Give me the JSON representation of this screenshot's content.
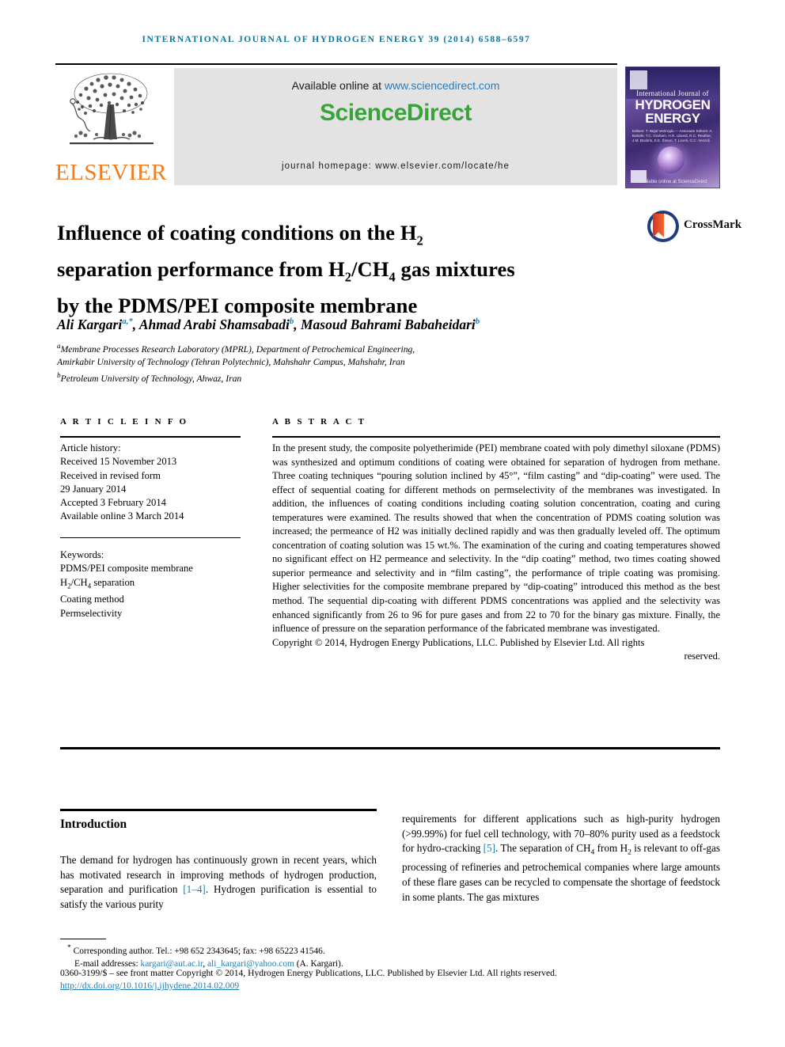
{
  "running_head": "International Journal of Hydrogen Energy 39 (2014) 6588–6597",
  "masthead": {
    "publisher_name": "ELSEVIER",
    "publisher_logo": "elsevier-tree-logo",
    "available_online_prefix": "Available online at ",
    "sciencedirect_url": "www.sciencedirect.com",
    "sciencedirect_logo_text": "ScienceDirect",
    "journal_homepage": "journal homepage: www.elsevier.com/locate/he",
    "cover": {
      "small_title": "International Journal of",
      "large_title_line1": "HYDROGEN",
      "large_title_line2": "ENERGY",
      "editors_text": "Editors: T. Nejat Veziroglu — Associate Editors: A. Bartels, T.C. Graham, H.R. Liburdi, R.C. Reuther, J.M. Bockris, E.E. Šimon, T. Loveli, G.C. Vezzoli",
      "footer_text": "Available online at ScienceDirect"
    }
  },
  "article": {
    "title_line1_pre": "Influence of coating conditions on the H",
    "title_h2_sub": "2",
    "title_line2_pre": "separation performance from H",
    "title_line2_mid": "/CH",
    "title_ch4_sub": "4",
    "title_line2_post": " gas mixtures",
    "title_line3": "by the PDMS/PEI composite membrane",
    "title_plain": "Influence of coating conditions on the H2 separation performance from H2/CH4 gas mixtures by the PDMS/PEI composite membrane",
    "crossmark_label": "CrossMark",
    "authors": [
      {
        "name": "Ali Kargari",
        "marks": "a,*"
      },
      {
        "name": "Ahmad Arabi Shamsabadi",
        "marks": "b"
      },
      {
        "name": "Masoud Bahrami Babaheidari",
        "marks": "b"
      }
    ],
    "affiliations": [
      {
        "mark": "a",
        "line1": "Membrane Processes Research Laboratory (MPRL), Department of Petrochemical Engineering,",
        "line2": "Amirkabir University of Technology (Tehran Polytechnic), Mahshahr Campus, Mahshahr, Iran"
      },
      {
        "mark": "b",
        "line1": "Petroleum University of Technology, Ahwaz, Iran",
        "line2": ""
      }
    ]
  },
  "article_info": {
    "heading": "A R T I C L E   I N F O",
    "history_label": "Article history:",
    "history": [
      "Received 15 November 2013",
      "Received in revised form",
      "29 January 2014",
      "Accepted 3 February 2014",
      "Available online 3 March 2014"
    ],
    "keywords_label": "Keywords:",
    "keywords": [
      "PDMS/PEI composite membrane",
      "H2/CH4 separation",
      "Coating method",
      "Permselectivity"
    ]
  },
  "abstract": {
    "heading": "A B S T R A C T",
    "body": "In the present study, the composite polyetherimide (PEI) membrane coated with poly dimethyl siloxane (PDMS) was synthesized and optimum conditions of coating were obtained for separation of hydrogen from methane. Three coating techniques “pouring solution inclined by 45°”, “film casting” and “dip-coating” were used. The effect of sequential coating for different methods on permselectivity of the membranes was investigated. In addition, the influences of coating conditions including coating solution concentration, coating and curing temperatures were examined. The results showed that when the concentration of PDMS coating solution was increased; the permeance of H2 was initially declined rapidly and was then gradually leveled off. The optimum concentration of coating solution was 15 wt.%. The examination of the curing and coating temperatures showed no significant effect on H2 permeance and selectivity. In the “dip coating” method, two times coating showed superior permeance and selectivity and in “film casting”, the performance of triple coating was promising. Higher selectivities for the composite membrane prepared by “dip-coating” introduced this method as the best method. The sequential dip-coating with different PDMS concentrations was applied and the selectivity was enhanced significantly from 26 to 96 for pure gases and from 22 to 70 for the binary gas mixture. Finally, the influence of pressure on the separation performance of the fabricated membrane was investigated.",
    "copyright": "Copyright © 2014, Hydrogen Energy Publications, LLC. Published by Elsevier Ltd. All rights",
    "copyright_last": "reserved."
  },
  "introduction": {
    "heading": "Introduction",
    "left_paragraph_pre": "The demand for hydrogen has continuously grown in recent years, which has motivated research in improving methods of hydrogen production, separation and purification ",
    "left_ref": "[1–4]",
    "left_paragraph_post": ". Hydrogen purification is essential to satisfy the various purity",
    "right_paragraph_pre": "requirements for different applications such as high-purity hydrogen (>99.99%) for fuel cell technology, with 70–80% purity used as a feedstock for hydro-cracking ",
    "right_ref": "[5]",
    "right_paragraph_mid": ". The separation of CH",
    "right_sub_4": "4",
    "right_paragraph_mid2": " from H",
    "right_sub_2": "2",
    "right_paragraph_post": " is relevant to off-gas processing of refineries and petrochemical companies where large amounts of these flare gases can be recycled to compensate the shortage of feedstock in some plants. The gas mixtures"
  },
  "footer": {
    "corresponding_star": "*",
    "corresponding_text": "Corresponding author. Tel.: +98 652 2343645; fax: +98 65223 41546.",
    "email_label": "E-mail addresses: ",
    "email1": "kargari@aut.ac.ir",
    "email_sep": ", ",
    "email2": "ali_kargari@yahoo.com",
    "email_suffix": " (A. Kargari).",
    "issn_line": "0360-3199/$ – see front matter Copyright © 2014, Hydrogen Energy Publications, LLC. Published by Elsevier Ltd. All rights reserved.",
    "doi": "http://dx.doi.org/10.1016/j.ijhydene.2014.02.009"
  },
  "colors": {
    "running_head": "#0b76a0",
    "elsevier_orange": "#f07c1f",
    "sciencedirect_green": "#3aa33a",
    "link_blue": "#1f7fb5",
    "masthead_gray": "#e3e3e3"
  }
}
